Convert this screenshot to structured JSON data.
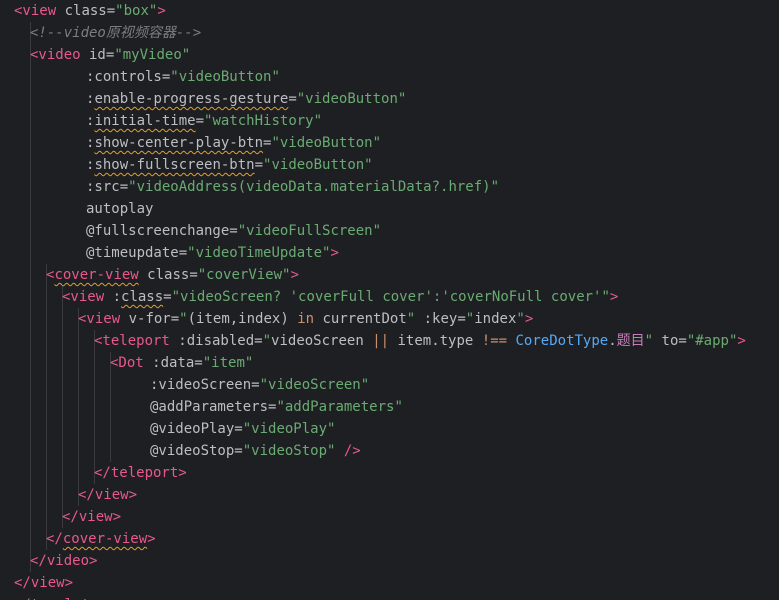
{
  "editor": {
    "background": "#1e1f22",
    "colors": {
      "tag": "#e8598b",
      "attr": "#bcbec4",
      "string": "#6aab73",
      "comment": "#7a7e85",
      "keyword": "#cf8e6d",
      "identifier": "#56a8f5",
      "enum_member": "#c77dbb",
      "squiggle": "#e0a030"
    },
    "lines": [
      {
        "indent": 0,
        "tokens": [
          [
            "t-tag",
            "<view"
          ],
          [
            "t-attr",
            " class"
          ],
          [
            "t-punct",
            "="
          ],
          [
            "t-str",
            "\"box\""
          ],
          [
            "t-tag",
            ">"
          ]
        ]
      },
      {
        "indent": 1,
        "tokens": [
          [
            "t-comment",
            "<!--video原视频容器-->"
          ]
        ]
      },
      {
        "indent": 1,
        "tokens": [
          [
            "t-tag",
            "<video"
          ],
          [
            "t-attr",
            " id"
          ],
          [
            "t-punct",
            "="
          ],
          [
            "t-str",
            "\"myVideo\""
          ]
        ]
      },
      {
        "indent": 4.5,
        "tokens": [
          [
            "t-attr",
            ":controls"
          ],
          [
            "t-punct",
            "="
          ],
          [
            "t-str",
            "\"videoButton\""
          ]
        ]
      },
      {
        "indent": 4.5,
        "tokens": [
          [
            "t-attr",
            ":"
          ],
          [
            "t-attr sq",
            "enable-progress-gesture"
          ],
          [
            "t-punct",
            "="
          ],
          [
            "t-str",
            "\"videoButton\""
          ]
        ]
      },
      {
        "indent": 4.5,
        "tokens": [
          [
            "t-attr",
            ":"
          ],
          [
            "t-attr sq",
            "initial-time"
          ],
          [
            "t-punct",
            "="
          ],
          [
            "t-str",
            "\"watchHistory\""
          ]
        ]
      },
      {
        "indent": 4.5,
        "tokens": [
          [
            "t-attr",
            ":"
          ],
          [
            "t-attr sq",
            "show-center-play-btn"
          ],
          [
            "t-punct",
            "="
          ],
          [
            "t-str",
            "\"videoButton\""
          ]
        ]
      },
      {
        "indent": 4.5,
        "tokens": [
          [
            "t-attr",
            ":"
          ],
          [
            "t-attr sq",
            "show-fullscreen-btn"
          ],
          [
            "t-punct",
            "="
          ],
          [
            "t-str",
            "\"videoButton\""
          ]
        ]
      },
      {
        "indent": 4.5,
        "tokens": [
          [
            "t-attr",
            ":src"
          ],
          [
            "t-punct",
            "="
          ],
          [
            "t-str",
            "\"videoAddress(videoData.materialData?.href)\""
          ]
        ]
      },
      {
        "indent": 4.5,
        "tokens": [
          [
            "t-attr",
            "autoplay"
          ]
        ]
      },
      {
        "indent": 4.5,
        "tokens": [
          [
            "t-attr",
            "@fullscreenchange"
          ],
          [
            "t-punct",
            "="
          ],
          [
            "t-str",
            "\"videoFullScreen\""
          ]
        ]
      },
      {
        "indent": 4.5,
        "tokens": [
          [
            "t-attr",
            "@timeupdate"
          ],
          [
            "t-punct",
            "="
          ],
          [
            "t-str",
            "\"videoTimeUpdate\""
          ],
          [
            "t-tag",
            ">"
          ]
        ]
      },
      {
        "indent": 2,
        "tokens": [
          [
            "t-tag",
            "<"
          ],
          [
            "t-tag sq",
            "cover-view"
          ],
          [
            "t-attr",
            " class"
          ],
          [
            "t-punct",
            "="
          ],
          [
            "t-str",
            "\"coverView\""
          ],
          [
            "t-tag",
            ">"
          ]
        ]
      },
      {
        "indent": 3,
        "tokens": [
          [
            "t-tag",
            "<view"
          ],
          [
            "t-attr",
            " :"
          ],
          [
            "t-attr sq",
            "class"
          ],
          [
            "t-punct",
            "="
          ],
          [
            "t-str",
            "\"videoScreen? 'coverFull cover':'coverNoFull cover'\""
          ],
          [
            "t-tag",
            ">"
          ]
        ]
      },
      {
        "indent": 4,
        "tokens": [
          [
            "t-tag",
            "<view"
          ],
          [
            "t-attr",
            " v-for"
          ],
          [
            "t-punct",
            "="
          ],
          [
            "t-str",
            "\""
          ],
          [
            "t-plain",
            "(item,index) "
          ],
          [
            "t-kw",
            "in"
          ],
          [
            "t-plain",
            " currentDot"
          ],
          [
            "t-str",
            "\""
          ],
          [
            "t-attr",
            " :key"
          ],
          [
            "t-punct",
            "="
          ],
          [
            "t-str",
            "\""
          ],
          [
            "t-plain",
            "index"
          ],
          [
            "t-str",
            "\""
          ],
          [
            "t-tag",
            ">"
          ]
        ]
      },
      {
        "indent": 5,
        "tokens": [
          [
            "t-tag",
            "<teleport"
          ],
          [
            "t-attr",
            " :disabled"
          ],
          [
            "t-punct",
            "="
          ],
          [
            "t-str",
            "\""
          ],
          [
            "t-plain",
            "videoScreen "
          ],
          [
            "t-kw",
            "||"
          ],
          [
            "t-plain",
            " item.type "
          ],
          [
            "t-kw",
            "!=="
          ],
          [
            "t-ident",
            " CoreDotType"
          ],
          [
            "t-plain",
            "."
          ],
          [
            "t-cn",
            "题目"
          ],
          [
            "t-str",
            "\""
          ],
          [
            "t-attr",
            " to"
          ],
          [
            "t-punct",
            "="
          ],
          [
            "t-str",
            "\"#app\""
          ],
          [
            "t-tag",
            ">"
          ]
        ]
      },
      {
        "indent": 6,
        "tokens": [
          [
            "t-tag",
            "<Dot"
          ],
          [
            "t-attr",
            " :data"
          ],
          [
            "t-punct",
            "="
          ],
          [
            "t-str",
            "\"item\""
          ]
        ]
      },
      {
        "indent": 8.5,
        "tokens": [
          [
            "t-attr",
            ":videoScreen"
          ],
          [
            "t-punct",
            "="
          ],
          [
            "t-str",
            "\"videoScreen\""
          ]
        ]
      },
      {
        "indent": 8.5,
        "tokens": [
          [
            "t-attr",
            "@addParameters"
          ],
          [
            "t-punct",
            "="
          ],
          [
            "t-str",
            "\"addParameters\""
          ]
        ]
      },
      {
        "indent": 8.5,
        "tokens": [
          [
            "t-attr",
            "@videoPlay"
          ],
          [
            "t-punct",
            "="
          ],
          [
            "t-str",
            "\"videoPlay\""
          ]
        ]
      },
      {
        "indent": 8.5,
        "tokens": [
          [
            "t-attr",
            "@videoStop"
          ],
          [
            "t-punct",
            "="
          ],
          [
            "t-str",
            "\"videoStop\""
          ],
          [
            "t-tag",
            " />"
          ]
        ]
      },
      {
        "indent": 5,
        "tokens": [
          [
            "t-tag",
            "</teleport>"
          ]
        ]
      },
      {
        "indent": 4,
        "tokens": [
          [
            "t-tag",
            "</view>"
          ]
        ]
      },
      {
        "indent": 3,
        "tokens": [
          [
            "t-tag",
            "</view>"
          ]
        ]
      },
      {
        "indent": 2,
        "tokens": [
          [
            "t-tag",
            "</"
          ],
          [
            "t-tag sq",
            "cover-view"
          ],
          [
            "t-tag",
            ">"
          ]
        ]
      },
      {
        "indent": 1,
        "tokens": [
          [
            "t-tag",
            "</video>"
          ]
        ]
      },
      {
        "indent": 0,
        "tokens": [
          [
            "t-tag",
            "</view>"
          ]
        ]
      },
      {
        "indent": 0,
        "tokens": [
          [
            "t-tag",
            "</template>"
          ]
        ]
      }
    ]
  }
}
